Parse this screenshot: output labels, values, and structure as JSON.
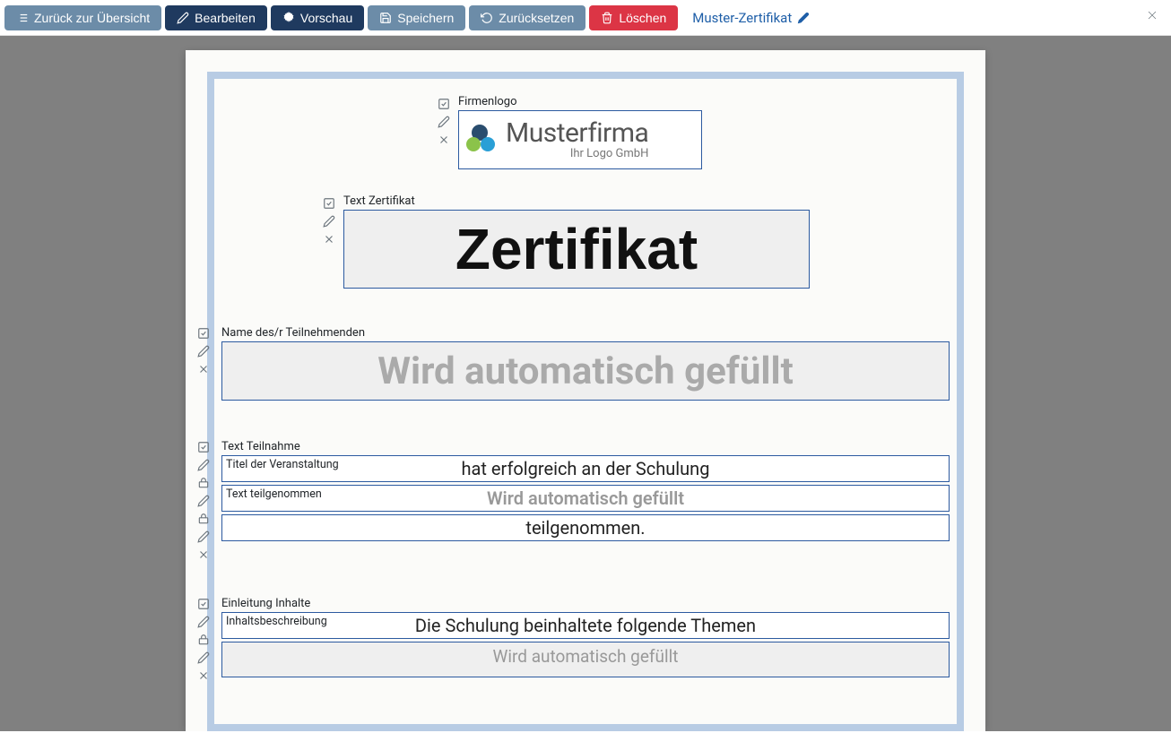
{
  "toolbar": {
    "back": "Zurück zur Übersicht",
    "edit": "Bearbeiten",
    "preview": "Vorschau",
    "save": "Speichern",
    "reset": "Zurücksetzen",
    "delete": "Löschen"
  },
  "title": "Muster-Zertifikat",
  "blocks": {
    "logo": {
      "label": "Firmenlogo",
      "company": "Musterfirma",
      "tagline": "Ihr Logo GmbH"
    },
    "certTitle": {
      "label": "Text Zertifikat",
      "value": "Zertifikat"
    },
    "participant": {
      "label": "Name des/r Teilnehmenden",
      "placeholder": "Wird automatisch gefüllt"
    },
    "participation": {
      "label1": "Text Teilnahme",
      "line1": "hat erfolgreich an der Schulung",
      "label2": "Titel der Veranstaltung",
      "line2": "Wird automatisch gefüllt",
      "label3": "Text teilgenommen",
      "line3": "teilgenommen."
    },
    "content": {
      "label1": "Einleitung Inhalte",
      "line1": "Die Schulung beinhaltete folgende Themen",
      "label2": "Inhaltsbeschreibung",
      "line2": "Wird automatisch gefüllt"
    }
  }
}
